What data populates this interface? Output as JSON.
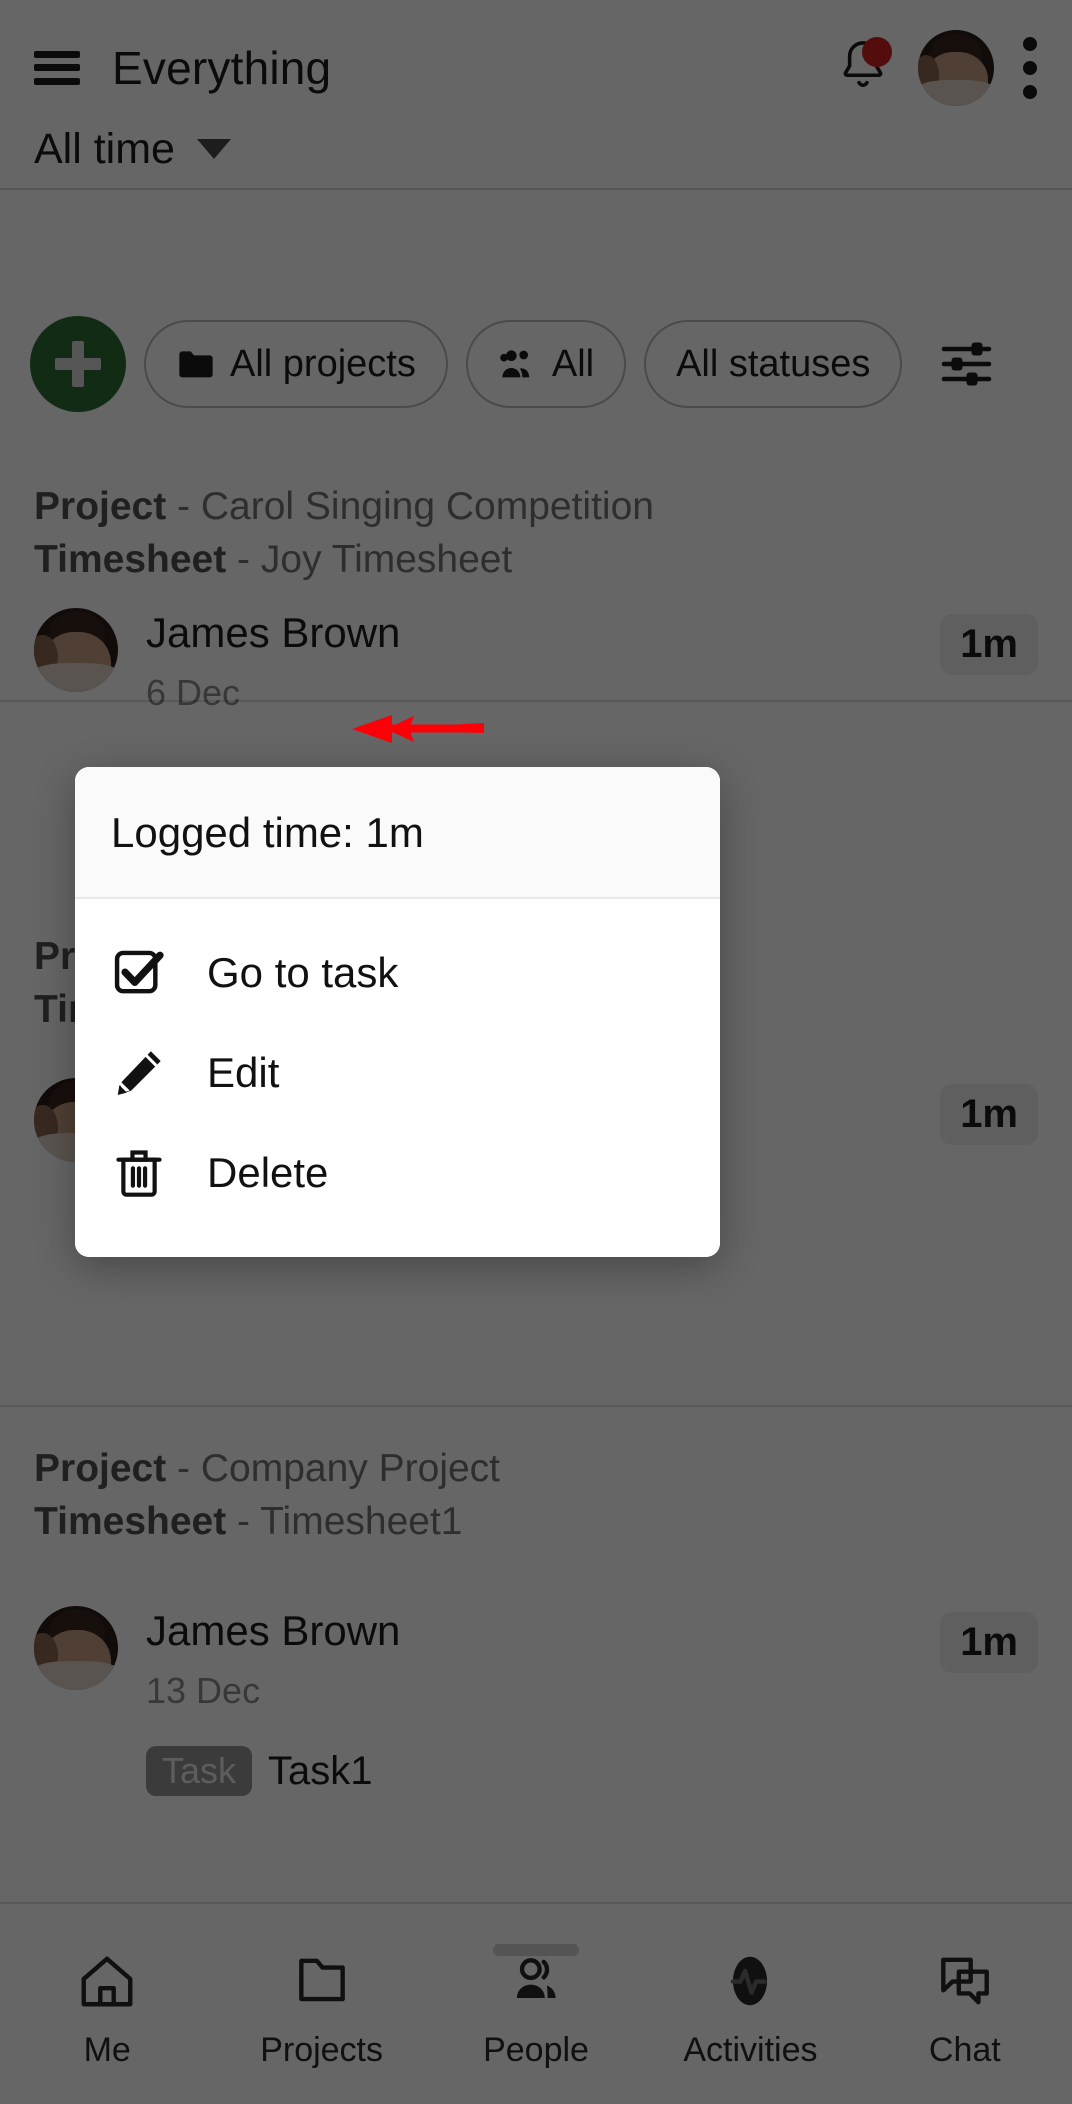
{
  "appbar": {
    "menu_icon": "hamburger-icon",
    "title": "Everything",
    "notifications_icon": "bell-icon",
    "notification_badge": "",
    "avatar_label": "user-avatar",
    "overflow_icon": "kebab-menu-icon"
  },
  "date_filter": {
    "label": "All time",
    "caret_icon": "chevron-down-icon"
  },
  "filters": {
    "add_label": "+",
    "chips": [
      {
        "label": "All projects",
        "icon": "folder-icon"
      },
      {
        "label": "All",
        "icon": "people-group-icon"
      },
      {
        "label": "All statuses",
        "icon": "none"
      }
    ],
    "settings_icon": "sliders-icon"
  },
  "groups": [
    {
      "project_label": "Project",
      "project_name": "Carol Singing Competition",
      "timesheet_label": "Timesheet",
      "timesheet_name": "Joy Timesheet",
      "entries": [
        {
          "name": "James Brown",
          "date": "6 Dec",
          "time": "1m"
        }
      ]
    },
    {
      "project_label": "Project",
      "project_name": "",
      "timesheet_label": "Timesheet",
      "timesheet_name": "",
      "entries": [
        {
          "name": "",
          "date": "",
          "time": "1m"
        }
      ]
    },
    {
      "project_label": "Project",
      "project_name": "Company Project",
      "timesheet_label": "Timesheet",
      "timesheet_name": "Timesheet1",
      "entries": [
        {
          "name": "James Brown",
          "date": "13 Dec",
          "time": "1m"
        }
      ],
      "task_badge": "Task",
      "task_name": "Task1"
    }
  ],
  "dialog": {
    "title": "Logged time: 1m",
    "items": [
      {
        "label": "Go to task",
        "icon": "checkbox-checked-icon"
      },
      {
        "label": "Edit",
        "icon": "pencil-icon"
      },
      {
        "label": "Delete",
        "icon": "trash-icon"
      }
    ]
  },
  "annotation": {
    "arrow_color": "#fb0007",
    "arrow_target": "Go to task"
  },
  "bottom_nav": [
    {
      "label": "Me",
      "icon": "home-icon"
    },
    {
      "label": "Projects",
      "icon": "folder-icon"
    },
    {
      "label": "People",
      "icon": "people-icon"
    },
    {
      "label": "Activities",
      "icon": "activity-pulse-icon"
    },
    {
      "label": "Chat",
      "icon": "chat-bubbles-icon"
    }
  ],
  "colors": {
    "accent_green": "#2c6b33",
    "badge_red": "#d32222",
    "arrow_red": "#fb0007",
    "scrim": "rgba(0,0,0,0.60)"
  }
}
